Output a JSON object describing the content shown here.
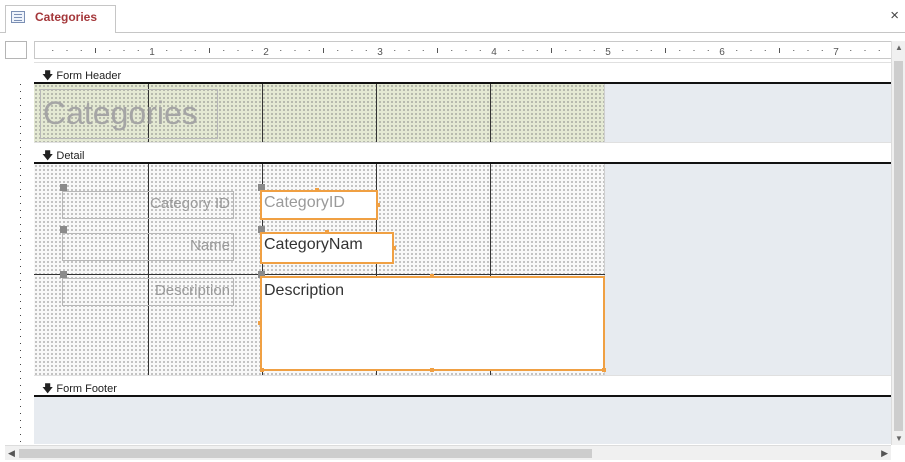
{
  "tab": {
    "title": "Categories",
    "icon": "form-icon"
  },
  "window": {
    "close_label": "×"
  },
  "ruler": {
    "numbers": [
      "1",
      "2",
      "3",
      "4",
      "5",
      "6",
      "7"
    ]
  },
  "sections": {
    "form_header": "Form Header",
    "detail": "Detail",
    "form_footer": "Form Footer"
  },
  "header_control": {
    "title": "Categories"
  },
  "labels": {
    "category_id": "Category ID",
    "name": "Name",
    "description": "Description"
  },
  "textboxes": {
    "category_id": "CategoryID",
    "category_name": "CategoryNam",
    "description": "Description"
  },
  "colors": {
    "tab_title": "#a4373a",
    "selection": "#f0a043",
    "header_grid": "#e4e9d3",
    "surface": "#e7ebf0"
  }
}
